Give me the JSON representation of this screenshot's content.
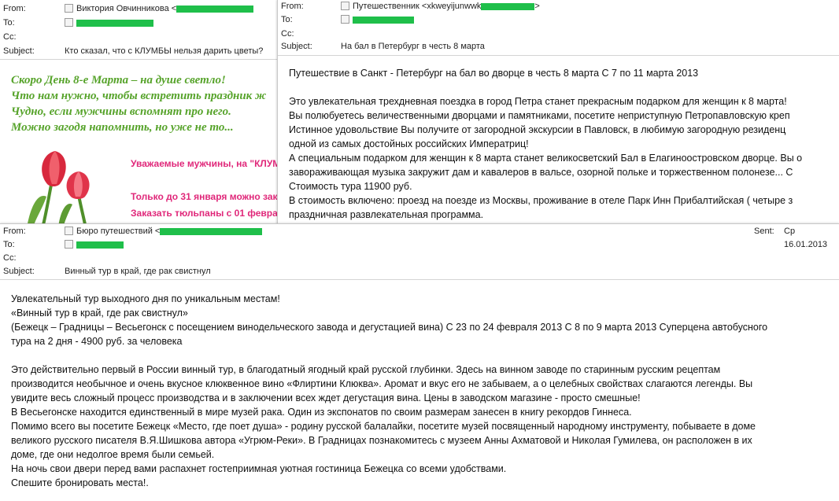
{
  "labels": {
    "from": "From:",
    "to": "To:",
    "cc": "Cc:",
    "subject": "Subject:",
    "sent": "Sent:"
  },
  "email1": {
    "from_name": "Виктория Овчинникова <",
    "subject": "Кто сказал, что с КЛУМБЫ нельзя дарить цветы?",
    "greeting": [
      "Скоро День 8-е Марта – на душе светло!",
      "Что нам нужно, чтобы встретить праздник ж",
      "Чудно, если мужчины вспомнят про него.",
      "Можно загодя напомнить, но уже не то..."
    ],
    "promo": [
      "Уважаемые мужчины, на \"КЛУМ",
      "Только до 31 января можно зака",
      "Заказать тюльпаны с 01 феврал"
    ]
  },
  "email2": {
    "from_name": "Путешественник <xkweyijunwwk",
    "from_suffix": ">",
    "subject": "На бал в Петербург в честь 8 марта",
    "body": [
      "Путешествие в Санкт - Петербург на бал во дворце в честь 8 марта С 7 по 11 марта 2013",
      "",
      "Это увлекательная трехдневная поездка в город Петра станет прекрасным подарком для женщин к 8 марта!",
      "Вы полюбуетесь величественными дворцами и памятниками, посетите неприступную Петропавловскую креп",
      "Истинное удовольствие Вы получите от загородной экскурсии в Павловск, в любимую загородную резиденц",
      "одной из самых достойных российских Императриц!",
      "А специальным подарком для женщин к 8 марта станет великосветский Бал в Елагиноостровском дворце. Вы о",
      "завораживающая музыка закружит дам и кавалеров в вальсе, озорной польке и торжественном полонезе... С",
      "Стоимость тура 11900 руб.",
      "В стоимость включено: проезд на поезде из Москвы, проживание в отеле Парк Инн Прибалтийская ( четыре з",
      "праздничная развлекательная программа."
    ]
  },
  "email3": {
    "from_name": "Бюро путешествий <",
    "subject": "Винный тур в край, где рак свистнул",
    "sent": "Ср 16.01.2013",
    "body": [
      "Увлекательный тур выходного дня по уникальным местам!",
      "«Винный тур в край, где рак свистнул»",
      "(Бежецк – Градницы – Весьегонск с посещением винодельческого завода и дегустацией вина) С 23 по 24 февраля 2013 С 8 по 9 марта 2013 Суперцена автобусного",
      "тура на 2 дня - 4900 руб. за человека",
      "",
      "Это действительно первый в России винный тур, в благодатный ягодный край русской глубинки. Здесь на винном заводе по старинным русским рецептам",
      "производится необычное и очень вкусное клюквенное вино «Флиртини Клюква». Аромат и вкус его не забываем, а о целебных свойствах слагаются легенды. Вы",
      "увидите весь сложный процесс производства и в заключении всех ждет дегустация вина. Цены в заводском магазине - просто смешные!",
      "В Весьегонске находится единственный в мире музей рака. Один из экспонатов по своим размерам занесен в книгу рекордов Гиннеса.",
      "Помимо всего вы посетите Бежецк «Место, где поет душа» - родину русской балалайки, посетите музей посвященный народному инструменту, побываете в доме",
      "великого русского писателя В.Я.Шишкова автора «Угрюм-Реки». В Градницах познакомитесь с музеем Анны Ахматовой и Николая Гумилева, он расположен в их",
      "доме, где они недолгое время были семьей.",
      "На ночь свои двери перед вами распахнет гостеприимная уютная гостиница Бежецка со всеми удобствами.",
      "Спешите бронировать места!."
    ]
  },
  "colors": {
    "redaction": "#1fbf4a",
    "greeting": "#56a32a",
    "promo": "#e0287a"
  }
}
